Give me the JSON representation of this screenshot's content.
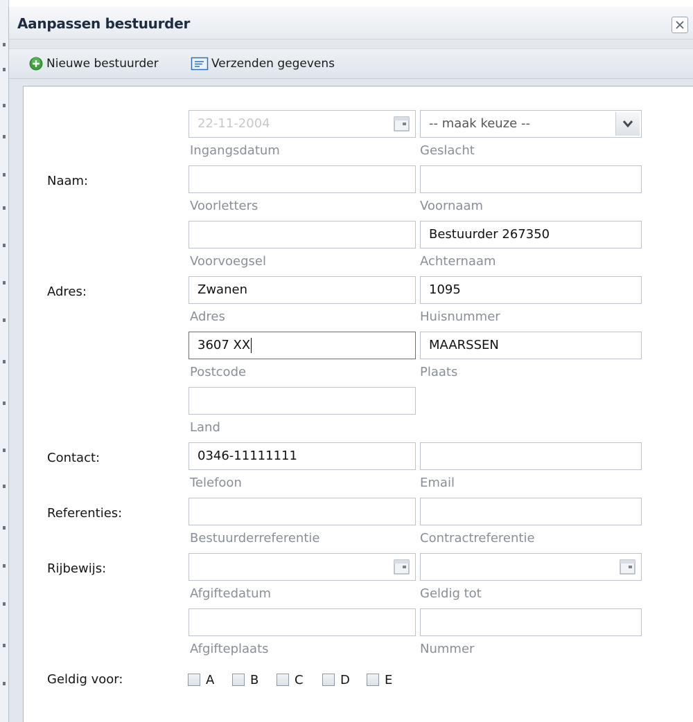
{
  "window": {
    "title": "Aanpassen bestuurder"
  },
  "toolbar": {
    "new_label": "Nieuwe bestuurder",
    "send_label": "Verzenden gegevens"
  },
  "labels": {
    "naam": "Naam:",
    "adres": "Adres:",
    "contact": "Contact:",
    "referenties": "Referenties:",
    "rijbewijs": "Rijbewijs:",
    "geldig_voor": "Geldig voor:"
  },
  "fields": {
    "ingangsdatum": {
      "value": "22-11-2004",
      "label": "Ingangsdatum"
    },
    "geslacht": {
      "value": "-- maak keuze --",
      "label": "Geslacht"
    },
    "voorletters": {
      "value": "",
      "label": "Voorletters"
    },
    "voornaam": {
      "value": "",
      "label": "Voornaam"
    },
    "voorvoegsel": {
      "value": "",
      "label": "Voorvoegsel"
    },
    "achternaam": {
      "value": "Bestuurder 267350",
      "label": "Achternaam"
    },
    "adres": {
      "value": "Zwanen",
      "label": "Adres"
    },
    "huisnummer": {
      "value": "1095",
      "label": "Huisnummer"
    },
    "postcode": {
      "value": "3607 XX",
      "label": "Postcode"
    },
    "plaats": {
      "value": "MAARSSEN",
      "label": "Plaats"
    },
    "land": {
      "value": "",
      "label": "Land"
    },
    "telefoon": {
      "value": "0346-11111111",
      "label": "Telefoon"
    },
    "email": {
      "value": "",
      "label": "Email"
    },
    "bestuurderreferentie": {
      "value": "",
      "label": "Bestuurderreferentie"
    },
    "contractreferentie": {
      "value": "",
      "label": "Contractreferentie"
    },
    "afgiftedatum": {
      "value": "",
      "label": "Afgiftedatum"
    },
    "geldig_tot": {
      "value": "",
      "label": "Geldig tot"
    },
    "afgifteplaats": {
      "value": "",
      "label": "Afgifteplaats"
    },
    "nummer": {
      "value": "",
      "label": "Nummer"
    }
  },
  "license_classes": [
    {
      "label": "A",
      "checked": false
    },
    {
      "label": "B",
      "checked": false
    },
    {
      "label": "C",
      "checked": false
    },
    {
      "label": "D",
      "checked": false
    },
    {
      "label": "E",
      "checked": false
    }
  ],
  "colors": {
    "title_text": "#1d2c3f",
    "add_icon_green": "#3aa13a",
    "send_icon_blue": "#2f6fb8",
    "disabled_text": "#c5c9ce",
    "sub_label": "#8a8f96"
  },
  "icons": {
    "close": "close-icon",
    "add": "plus-circle-icon",
    "send": "form-send-icon",
    "calendar": "calendar-icon",
    "dropdown": "chevron-down-icon"
  }
}
